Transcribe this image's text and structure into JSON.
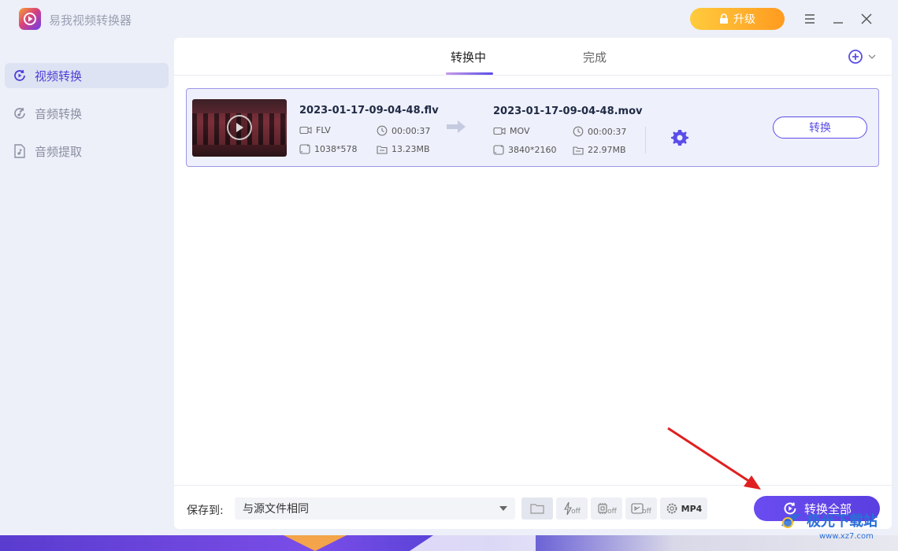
{
  "app": {
    "title": "易我视频转换器",
    "upgrade_label": "升级"
  },
  "window": {
    "menu_icon": "menu-icon",
    "minimize_icon": "minimize-icon",
    "close_icon": "close-icon"
  },
  "sidebar": {
    "items": [
      {
        "label": "视频转换",
        "icon": "video-convert-icon",
        "active": true
      },
      {
        "label": "音频转换",
        "icon": "audio-convert-icon",
        "active": false
      },
      {
        "label": "音频提取",
        "icon": "audio-extract-icon",
        "active": false
      }
    ]
  },
  "tabs": {
    "converting": "转换中",
    "done": "完成"
  },
  "file": {
    "source": {
      "name": "2023-01-17-09-04-48.flv",
      "format": "FLV",
      "duration": "00:00:37",
      "resolution": "1038*578",
      "size": "13.23MB"
    },
    "target": {
      "name": "2023-01-17-09-04-48.mov",
      "format": "MOV",
      "duration": "00:00:37",
      "resolution": "3840*2160",
      "size": "22.97MB"
    },
    "convert_label": "转换"
  },
  "bottom": {
    "save_to_label": "保存到:",
    "save_to_value": "与源文件相同",
    "off_label": "off",
    "format_label": "MP4",
    "convert_all_label": "转换全部"
  },
  "watermark": {
    "text": "极光下载站",
    "url": "www.xz7.com"
  },
  "colors": {
    "accent": "#5b4de8",
    "upgrade": "#ffb02e",
    "annotation": "#e02020"
  }
}
